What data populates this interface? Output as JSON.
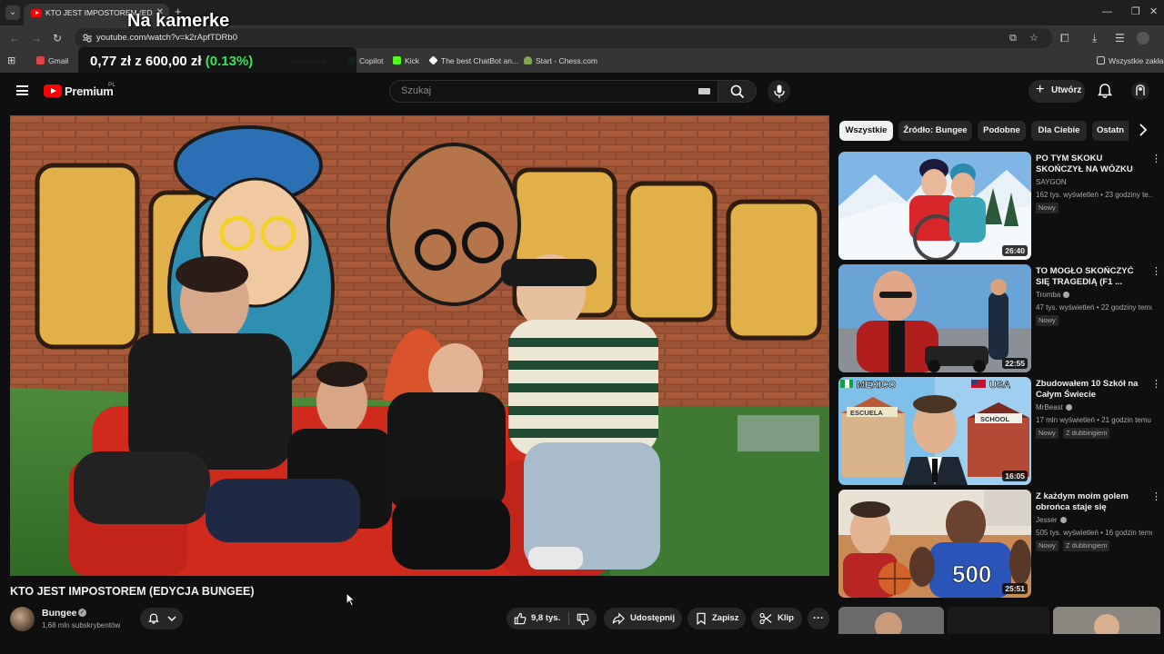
{
  "browser": {
    "tab_title": "KTO JEST IMPOSTOREM (ED",
    "url": "youtube.com/watch?v=k2rApfTDRb0",
    "bookmarks": [
      "Gmail",
      "geoguessr",
      "Copilot",
      "Kick",
      "The best ChatBot an...",
      "Start - Chess.com"
    ],
    "bookmarks_right": "Wszystkie zakład"
  },
  "overlay": {
    "title": "Na kamerke",
    "ticker_value": "0,77 zł",
    "ticker_of": "z",
    "ticker_goal": "600,00 zł",
    "ticker_pct": "(0.13%)"
  },
  "header": {
    "brand": "Premium",
    "country": "PL",
    "search_placeholder": "Szukaj",
    "create_label": "Utwórz"
  },
  "video": {
    "title": "KTO JEST IMPOSTOREM (EDYCJA BUNGEE)",
    "channel": "Bungee",
    "subscribers": "1,68 mln subskrybentów",
    "likes": "9,8 tys.",
    "share_label": "Udostępnij",
    "save_label": "Zapisz",
    "clip_label": "Klip"
  },
  "chips": [
    "Wszystkie",
    "Źródło: Bungee",
    "Podobne",
    "Dla Ciebie",
    "Ostatn"
  ],
  "recommendations": [
    {
      "title": "PO TYM SKOKU SKOŃCZYŁ NA WÓZKU",
      "channel": "SAYGON",
      "meta": "162 tys. wyświetleń • 23 godziny te...",
      "badge": "Nowy",
      "duration": "26:40"
    },
    {
      "title": "TO MOGŁO SKOŃCZYĆ SIĘ TRAGEDIĄ (F1 ...",
      "channel": "Tromba",
      "meta": "47 tys. wyświetleń • 22 godziny temu",
      "badge": "Nowy",
      "duration": "22:55"
    },
    {
      "title": "Zbudowałem 10 Szkół na Całym Świecie",
      "channel": "MrBeast",
      "meta": "17 mln wyświetleń • 21 godzin temu",
      "badge": "Nowy",
      "badge2": "Z dubbingiem",
      "duration": "16:05",
      "thumb_left": "MEXICO",
      "thumb_right": "USA",
      "thumb_sign1": "ESCUELA",
      "thumb_sign2": "SCHOOL"
    },
    {
      "title": "Z każdym moim golem obrońca staje się silniejszy!",
      "channel": "Jesser",
      "meta": "505 tys. wyświetleń • 16 godzin temu",
      "badge": "Nowy",
      "badge2": "Z dubbingiem",
      "duration": "25:51",
      "thumb_number": "500"
    }
  ],
  "colors": {
    "brand_red": "#ff0000",
    "background": "#0f0f0f",
    "ticker_green": "#3be25b"
  }
}
